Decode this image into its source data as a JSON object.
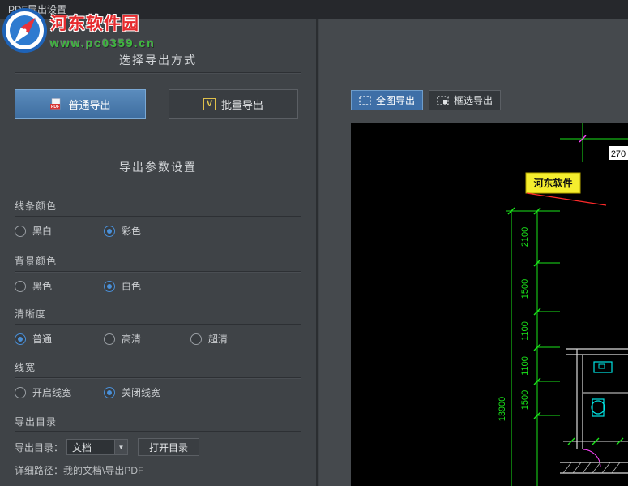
{
  "window": {
    "title": "PDF导出设置"
  },
  "watermark": {
    "line1": "河东软件园",
    "line2": "www.pc0359.cn"
  },
  "left_panel": {
    "section_export_method": "选择导出方式",
    "buttons": {
      "normal": "普通导出",
      "batch": "批量导出",
      "batch_icon_letter": "V"
    },
    "section_params": "导出参数设置",
    "line_color": {
      "label": "线条颜色",
      "options": [
        {
          "label": "黑白",
          "selected": false
        },
        {
          "label": "彩色",
          "selected": true
        }
      ]
    },
    "bg_color": {
      "label": "背景颜色",
      "options": [
        {
          "label": "黑色",
          "selected": false
        },
        {
          "label": "白色",
          "selected": true
        }
      ]
    },
    "clarity": {
      "label": "清晰度",
      "options": [
        {
          "label": "普通",
          "selected": true
        },
        {
          "label": "高清",
          "selected": false
        },
        {
          "label": "超清",
          "selected": false
        }
      ]
    },
    "line_width": {
      "label": "线宽",
      "options": [
        {
          "label": "开启线宽",
          "selected": false
        },
        {
          "label": "关闭线宽",
          "selected": true
        }
      ]
    },
    "export_dir": {
      "label": "导出目录",
      "row_label": "导出目录：",
      "dropdown_value": "文档",
      "dropdown_arrow": "▼",
      "open_button": "打开目录",
      "path": "详细路径：我的文档\\导出PDF"
    }
  },
  "preview": {
    "toolbar": {
      "full_export": "全图导出",
      "box_export": "框选导出"
    },
    "cad": {
      "top_dim": "270",
      "brand_label": "河东软件",
      "dims": [
        "2100",
        "1500",
        "1100",
        "1100",
        "1500"
      ],
      "total": "13900"
    }
  },
  "colors": {
    "accent_blue": "#3e6fa7",
    "radio_blue": "#4a90d8",
    "cad_green": "#1ae51a",
    "cad_cyan": "#00e5e5",
    "cad_magenta": "#ff44ff",
    "cad_red": "#ff2a2a",
    "brand_yellow": "#f5ee2e",
    "panel_bg": "#3f4347",
    "titlebar_bg": "#26282c",
    "canvas_bg": "#000000"
  }
}
